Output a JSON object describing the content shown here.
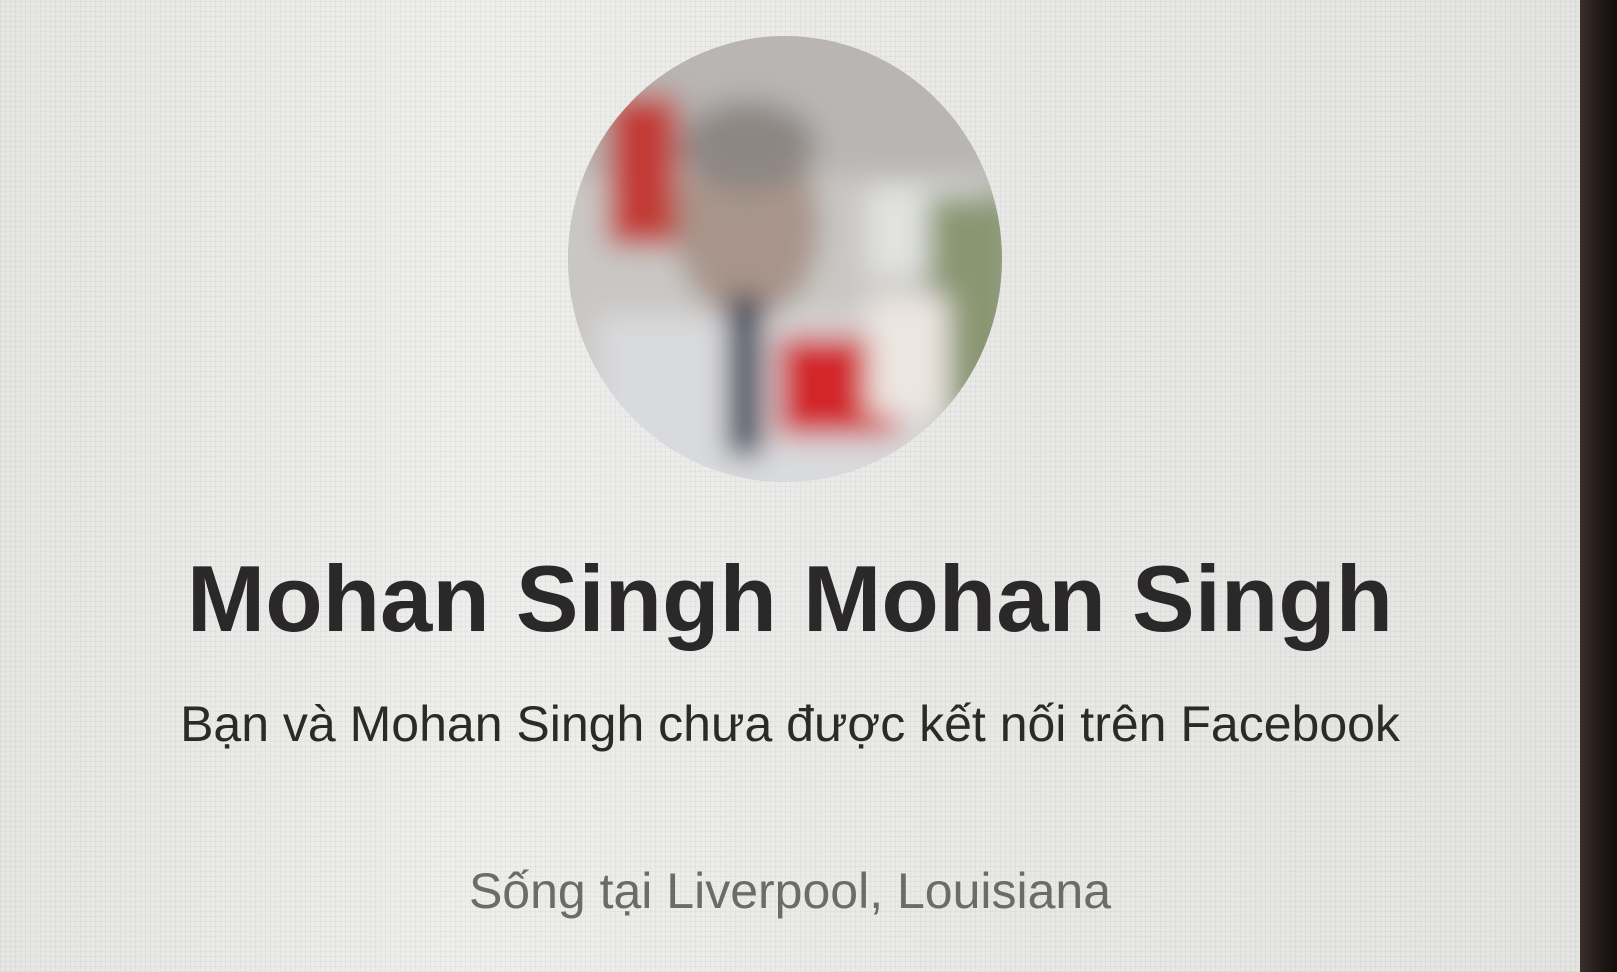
{
  "profile": {
    "name": "Mohan Singh Mohan Singh",
    "connection_status": "Bạn và Mohan Singh chưa được kết nối trên Facebook",
    "location": "Sống tại Liverpool, Louisiana"
  },
  "icons": {
    "avatar": "profile-photo-blurred"
  },
  "colors": {
    "name_text": "#2a2828",
    "body_text": "#2b2a29",
    "secondary_text": "#6d6b69",
    "background": "#ebebe9"
  }
}
